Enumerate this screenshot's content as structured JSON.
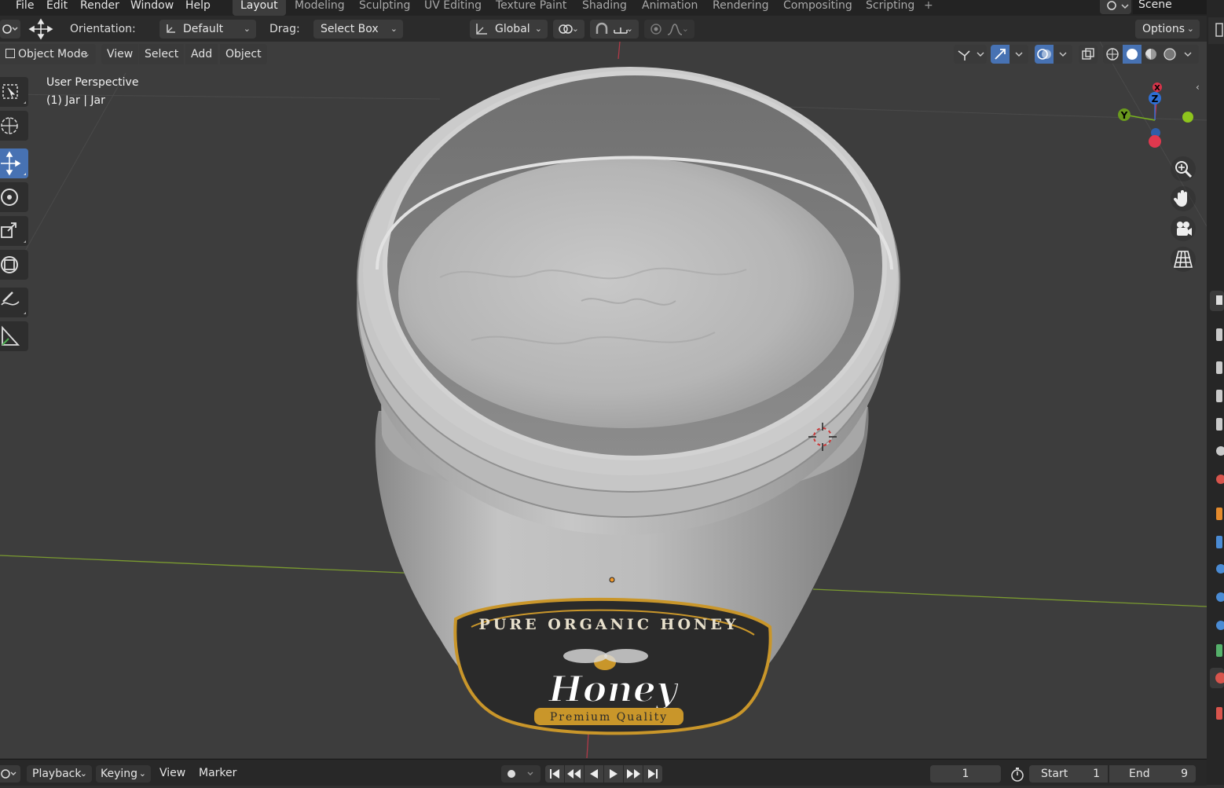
{
  "menu": {
    "file": "File",
    "edit": "Edit",
    "render": "Render",
    "window": "Window",
    "help": "Help"
  },
  "workspaces": [
    "Layout",
    "Modeling",
    "Sculpting",
    "UV Editing",
    "Texture Paint",
    "Shading",
    "Animation",
    "Rendering",
    "Compositing",
    "Scripting"
  ],
  "active_workspace": "Layout",
  "add_workspace": "+",
  "scene_name": "Scene",
  "toolbar": {
    "orientation_label": "Orientation:",
    "orientation_value": "Default",
    "drag_label": "Drag:",
    "drag_value": "Select Box",
    "transform_orientation": "Global",
    "options": "Options"
  },
  "viewport_header": {
    "mode": "Object Mode",
    "view": "View",
    "select": "Select",
    "add": "Add",
    "object": "Object"
  },
  "overlay_text": {
    "perspective": "User Perspective",
    "object_info": "(1) Jar | Jar"
  },
  "gizmo": {
    "x": "X",
    "y": "Y",
    "z": "Z"
  },
  "label": {
    "top_text": "PURE ORGANIC HONEY",
    "main_text": "Honey",
    "bottom_text": "Premium Quality"
  },
  "timeline": {
    "playback": "Playback",
    "keying": "Keying",
    "view": "View",
    "marker": "Marker",
    "current_frame": "1",
    "start_label": "Start",
    "start_value": "1",
    "end_label": "End",
    "end_value": "9"
  },
  "colors": {
    "accent": "#4772b3",
    "axis_x": "#d7344a",
    "axis_y": "#7ab51d",
    "axis_z": "#2f6fd4",
    "label_gold": "#c9962a",
    "viewport_bg": "#3d3d3d"
  }
}
